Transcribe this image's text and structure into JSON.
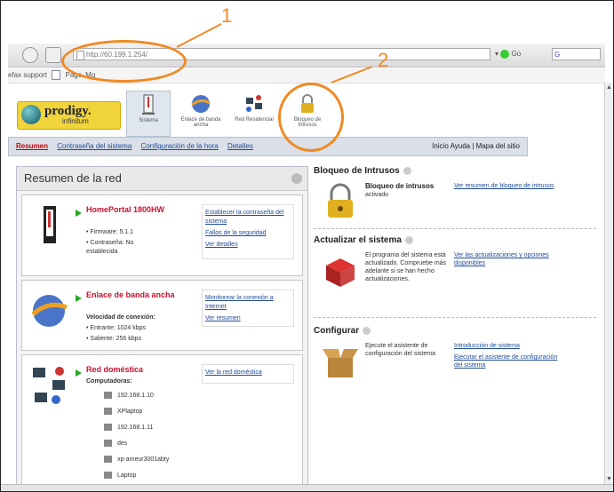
{
  "browser": {
    "url": "http://60.199.1.254/",
    "go_label": "Go",
    "search_text": "G",
    "links_bar": [
      "efax support",
      "Págs. Mg"
    ]
  },
  "header": {
    "logo_name": "prodigy.",
    "logo_sub": "infinitum",
    "apps": [
      {
        "label": "Sistema",
        "icon": "system-icon"
      },
      {
        "label": "Enlace de banda ancha",
        "icon": "broadband-globe-icon"
      },
      {
        "label": "Red Residencial",
        "icon": "home-network-icon"
      },
      {
        "label": "Bloqueo de Intrusos",
        "icon": "padlock-icon"
      }
    ]
  },
  "subnav": {
    "items": [
      "Resumen",
      "Contraseña del sistema",
      "Configuración de la hora",
      "Detalles"
    ],
    "selected": 0,
    "right_text": "Inicio   Ayuda | Mapa del sitio"
  },
  "left_panel": {
    "title": "Resumen de la red",
    "cards": [
      {
        "title": "HomePortal 1800HW",
        "lines": [
          "• Firmware: 5.1.1",
          "• Contraseña: No",
          "  establecida"
        ],
        "links": [
          "Establecer la contraseña del sistema",
          "Fallos de la seguridad",
          "Ver detalles"
        ]
      },
      {
        "title": "Enlace de banda ancha",
        "lines": [
          "Velocidad de conexión:",
          "• Entrante: 1024 kbps",
          "• Saliente: 256 kbps"
        ],
        "links": [
          "Monitorear la conexión a Internet",
          "Ver resumen"
        ]
      },
      {
        "title": "Red doméstica",
        "lines": [
          "Computadoras:"
        ],
        "links": [
          "Ver la red doméstica"
        ],
        "computers": [
          "192.168.1.10",
          "XPlaptop",
          "192.168.1.11",
          "des",
          "xp-ameur3001abty",
          "Laptop"
        ]
      }
    ]
  },
  "right_panel": {
    "sections": [
      {
        "title": "Bloqueo de Intrusos",
        "desc_title": "Bloqueo de intrusos",
        "desc": "activado",
        "icon": "padlock-icon",
        "links": [
          "Ver resumen de bloqueo de intrusos"
        ]
      },
      {
        "title": "Actualizar el sistema",
        "desc": "El programa del sistema está actualizado. Compruebe más adelante si se han hecho actualizaciones.",
        "icon": "update-box-icon",
        "links": [
          "Ver las actualizaciones y opciones disponibles"
        ]
      },
      {
        "title": "Configurar",
        "desc": "Ejecute el asistente de configuración del sistema",
        "icon": "open-box-icon",
        "links": [
          "Introducción de sistema",
          "Ejecutar el asistente de configuración del sistema"
        ]
      }
    ]
  },
  "annotations": {
    "label_1": "1",
    "label_2": "2"
  },
  "colors": {
    "annotation": "#f08a24",
    "link": "#214c98",
    "accent_red": "#c8102e"
  }
}
